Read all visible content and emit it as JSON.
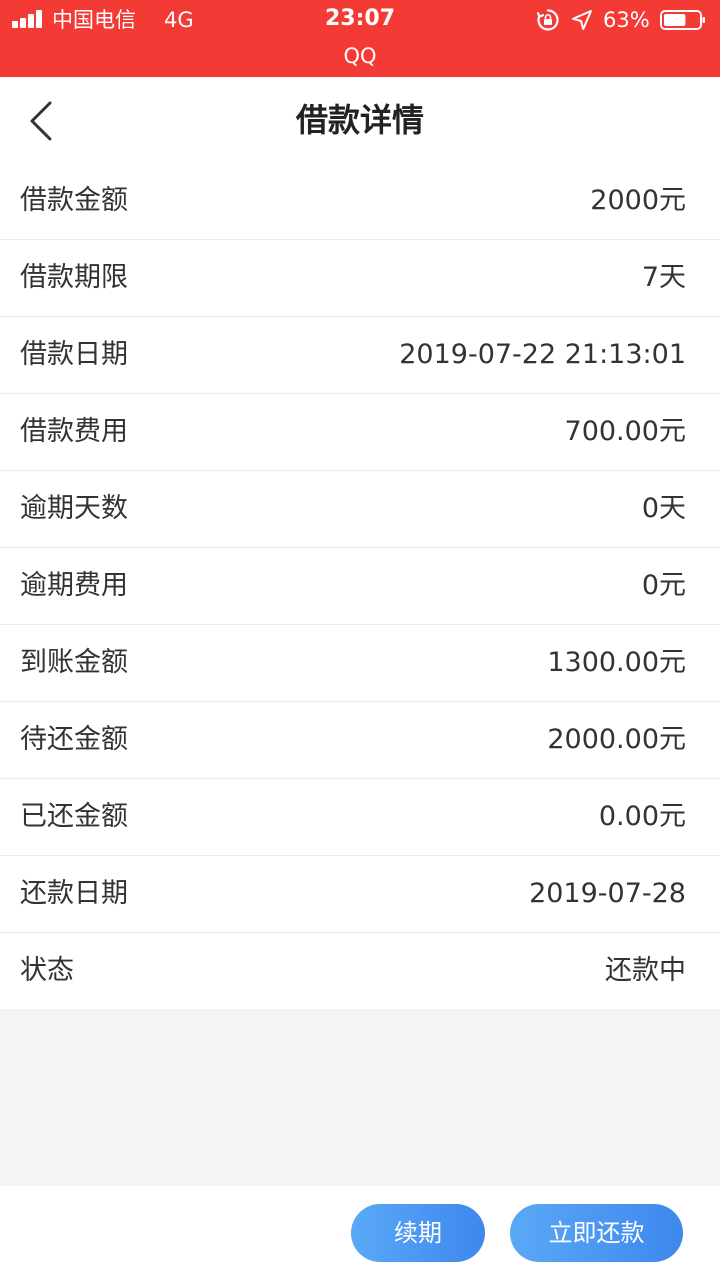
{
  "status_bar": {
    "carrier": "中国电信",
    "network": "4G",
    "time": "23:07",
    "sub_app": "QQ",
    "battery": "63%",
    "battery_level": 0.63,
    "color": "#f33a34"
  },
  "nav": {
    "title": "借款详情",
    "back_icon": "chevron-left-icon"
  },
  "details": [
    {
      "label": "借款金额",
      "value": "2000元"
    },
    {
      "label": "借款期限",
      "value": "7天"
    },
    {
      "label": "借款日期",
      "value": "2019-07-22 21:13:01"
    },
    {
      "label": "借款费用",
      "value": "700.00元"
    },
    {
      "label": "逾期天数",
      "value": "0天"
    },
    {
      "label": "逾期费用",
      "value": "0元"
    },
    {
      "label": "到账金额",
      "value": "1300.00元"
    },
    {
      "label": "待还金额",
      "value": "2000.00元"
    },
    {
      "label": "已还金额",
      "value": "0.00元"
    },
    {
      "label": "还款日期",
      "value": "2019-07-28"
    },
    {
      "label": "状态",
      "value": "还款中"
    }
  ],
  "footer": {
    "renew_label": "续期",
    "repay_label": "立即还款",
    "button_color": "#4a96f2"
  }
}
